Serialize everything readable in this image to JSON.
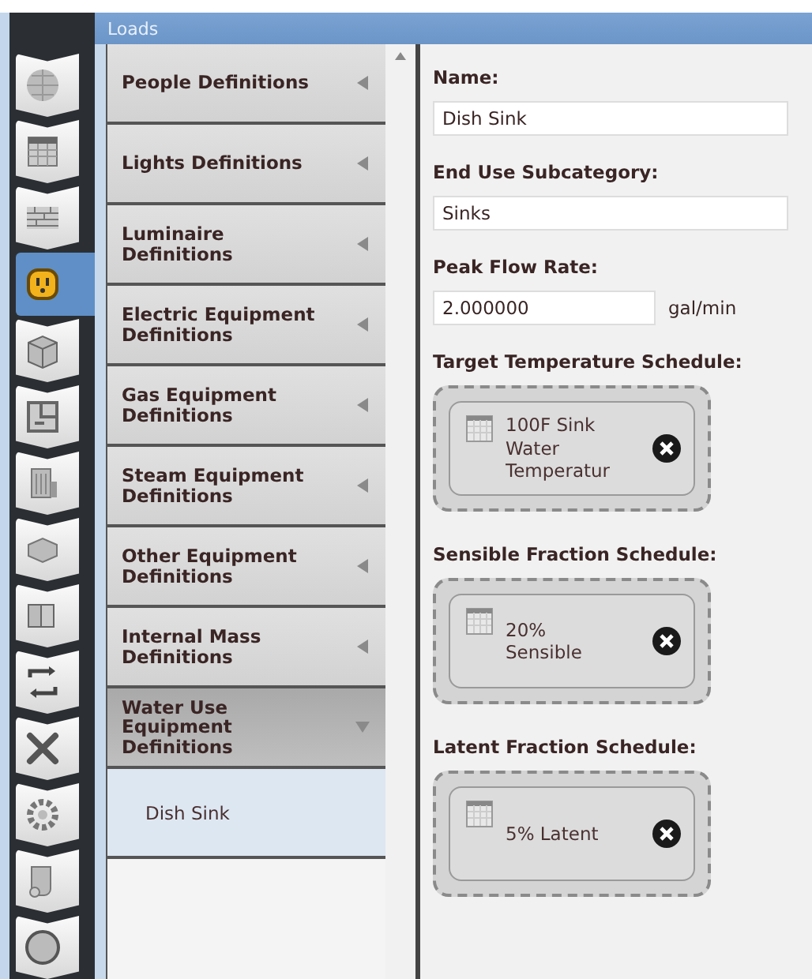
{
  "sidebar": {
    "tabs": [
      {
        "selected": false
      },
      {
        "selected": false
      },
      {
        "selected": false
      },
      {
        "selected": true
      },
      {
        "selected": false
      },
      {
        "selected": false
      },
      {
        "selected": false
      },
      {
        "selected": false
      },
      {
        "selected": false
      },
      {
        "selected": false
      },
      {
        "selected": false
      },
      {
        "selected": false
      },
      {
        "selected": false
      },
      {
        "selected": false
      }
    ]
  },
  "header": {
    "title": "Loads"
  },
  "list": {
    "items": [
      {
        "label": "People Definitions",
        "expanded": false
      },
      {
        "label": "Lights Definitions",
        "expanded": false
      },
      {
        "label": "Luminaire Definitions",
        "expanded": false
      },
      {
        "label": "Electric Equipment Definitions",
        "expanded": false
      },
      {
        "label": "Gas Equipment Definitions",
        "expanded": false
      },
      {
        "label": "Steam Equipment Definitions",
        "expanded": false
      },
      {
        "label": "Other Equipment Definitions",
        "expanded": false
      },
      {
        "label": "Internal Mass Definitions",
        "expanded": false
      },
      {
        "label": "Water Use Equipment Definitions",
        "expanded": true,
        "children": [
          {
            "label": "Dish Sink",
            "selected": true
          }
        ]
      }
    ]
  },
  "form": {
    "fields": [
      {
        "label": "Name:",
        "value": "Dish Sink"
      },
      {
        "label": "End Use Subcategory:",
        "value": "Sinks"
      },
      {
        "label": "Peak Flow Rate:",
        "value": "2.000000",
        "unit": "gal/min"
      }
    ],
    "schedules": [
      {
        "label": "Target Temperature Schedule:",
        "value": "100F Sink Water Temperatur"
      },
      {
        "label": "Sensible Fraction Schedule:",
        "value": "20% Sensible"
      },
      {
        "label": "Latent Fraction Schedule:",
        "value": "5% Latent"
      }
    ]
  }
}
